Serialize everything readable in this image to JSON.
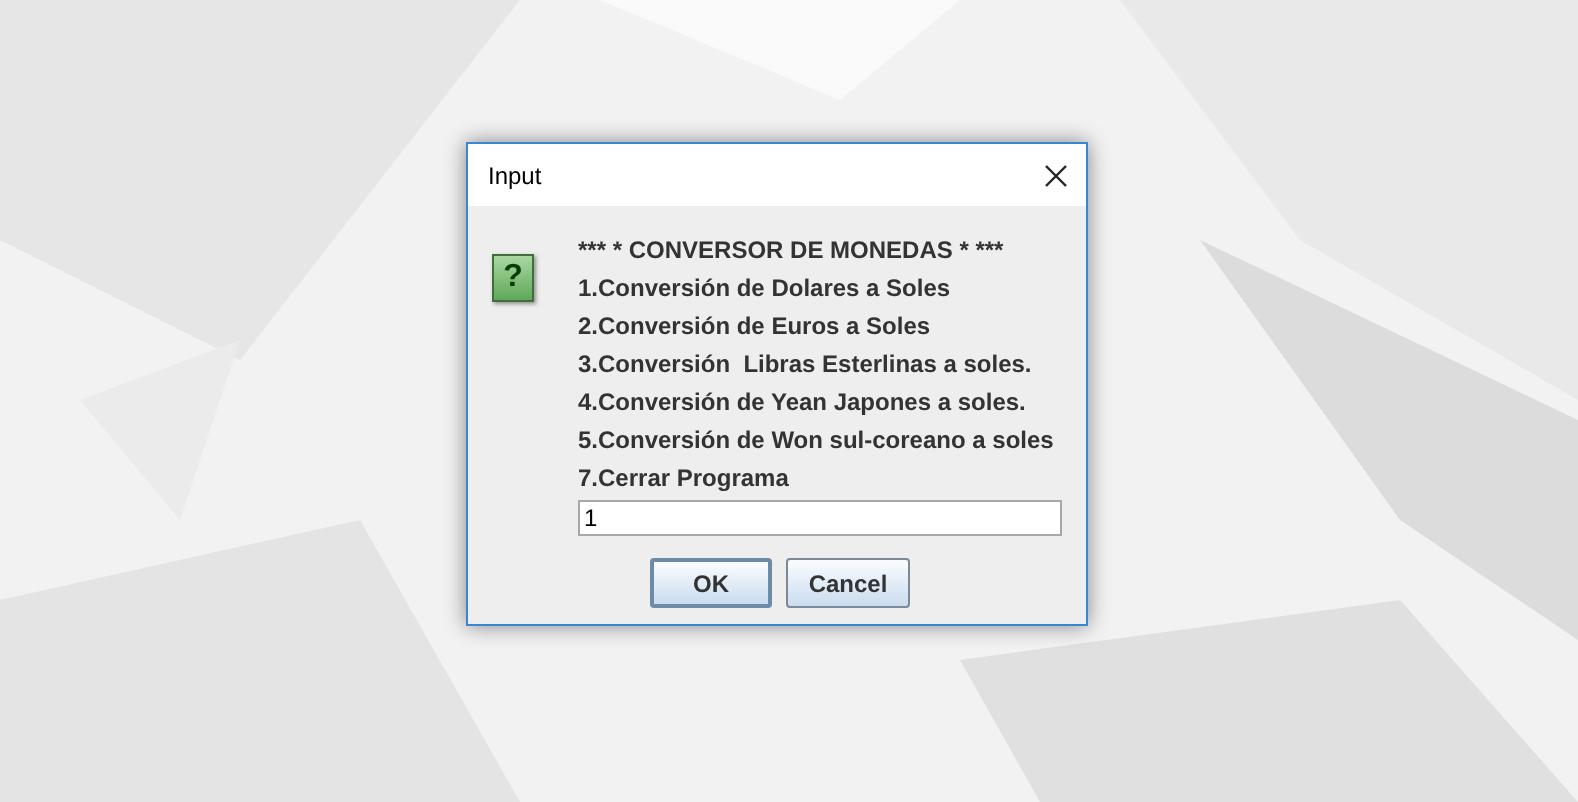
{
  "window": {
    "title": "Input"
  },
  "icon": {
    "glyph": "?"
  },
  "message_lines": [
    "*** * CONVERSOR DE MONEDAS * ***",
    "1.Conversión de Dolares a Soles",
    "2.Conversión de Euros a Soles",
    "3.Conversión  Libras Esterlinas a soles.",
    "4.Conversión de Yean Japones a soles.",
    "5.Conversión de Won sul-coreano a soles",
    "7.Cerrar Programa"
  ],
  "input": {
    "value": "1"
  },
  "buttons": [
    {
      "label": "OK",
      "selected": true
    },
    {
      "label": "Cancel",
      "selected": false
    }
  ]
}
